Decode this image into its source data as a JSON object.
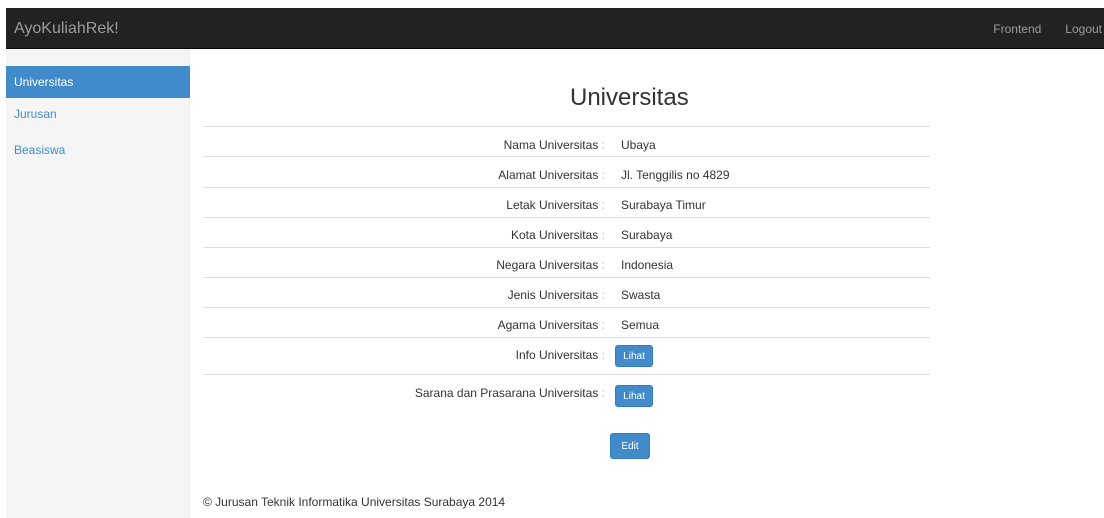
{
  "navbar": {
    "brand": "AyoKuliahRek!",
    "frontend": "Frontend",
    "logout": "Logout"
  },
  "sidebar": {
    "items": [
      {
        "label": "Universitas",
        "active": true
      },
      {
        "label": "Jurusan",
        "active": false
      },
      {
        "label": "Beasiswa",
        "active": false
      }
    ]
  },
  "page": {
    "title": "Universitas"
  },
  "details": [
    {
      "label": "Nama Universitas",
      "value": "Ubaya"
    },
    {
      "label": "Alamat Universitas",
      "value": "Jl. Tenggilis no 4829"
    },
    {
      "label": "Letak Universitas",
      "value": "Surabaya Timur"
    },
    {
      "label": "Kota Universitas",
      "value": "Surabaya"
    },
    {
      "label": "Negara Universitas",
      "value": "Indonesia"
    },
    {
      "label": "Jenis Universitas",
      "value": "Swasta"
    },
    {
      "label": "Agama Universitas",
      "value": "Semua"
    },
    {
      "label": "Info Universitas",
      "button": "Lihat"
    },
    {
      "label": "Sarana dan Prasarana Universitas",
      "button": "Lihat"
    }
  ],
  "colon": ":",
  "actions": {
    "edit": "Edit"
  },
  "footer": {
    "text": "© Jurusan Teknik Informatika Universitas Surabaya 2014"
  },
  "colors": {
    "navbar": "#222222",
    "accent": "#428bca",
    "sidebar": "#f5f5f5"
  }
}
